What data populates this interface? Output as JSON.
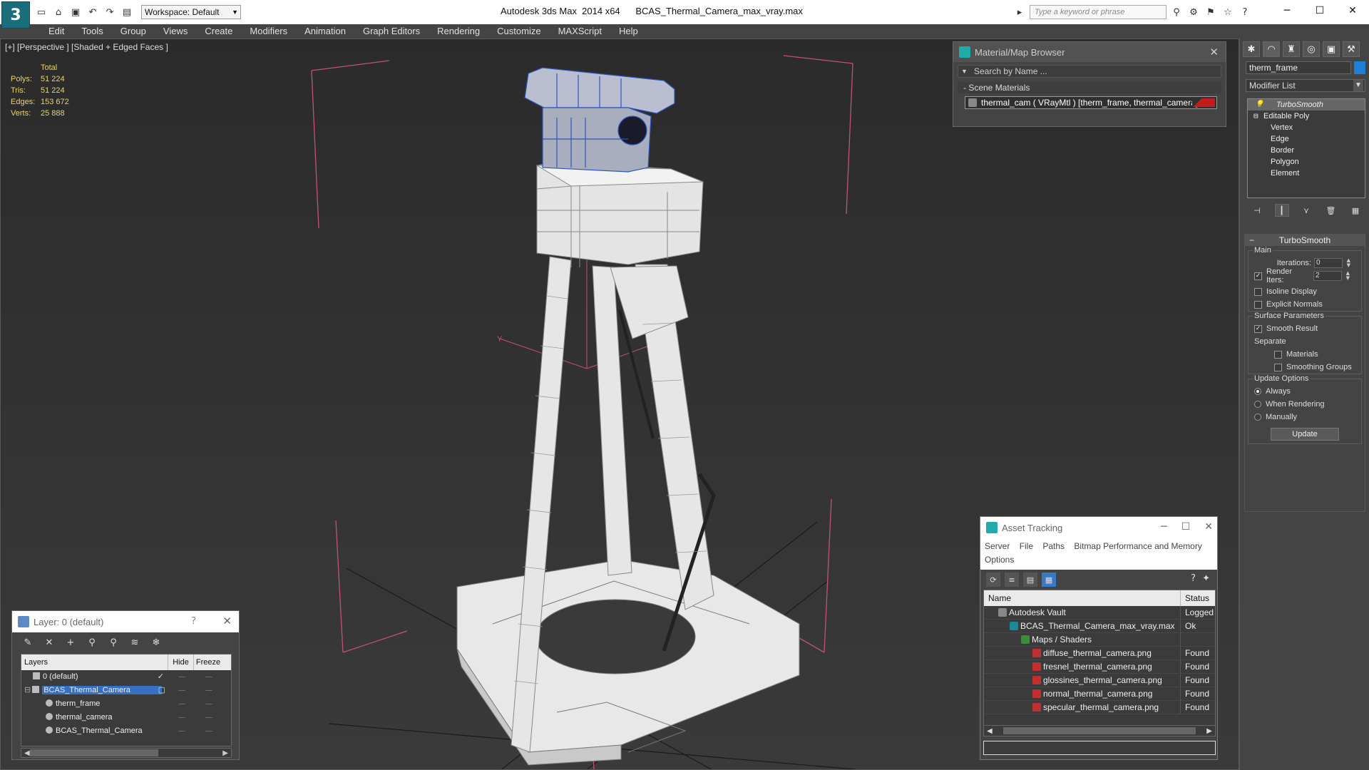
{
  "app": {
    "logo_glyph": "3",
    "window_title": "Autodesk 3ds Max  2014 x64      BCAS_Thermal_Camera_max_vray.max",
    "workspace": "Workspace: Default",
    "search_placeholder": "Type a keyword or phrase",
    "qat_icons": [
      "new-file-icon",
      "open-file-icon",
      "save-icon",
      "undo-icon",
      "redo-icon",
      "project-folder-icon"
    ],
    "title_icons": [
      "binoculars-icon",
      "exchange-icon",
      "infocenter-icon",
      "favorites-star-icon",
      "help-icon"
    ],
    "window_controls": [
      "minimize-icon",
      "maximize-icon",
      "close-icon"
    ]
  },
  "menu": [
    "Edit",
    "Tools",
    "Group",
    "Views",
    "Create",
    "Modifiers",
    "Animation",
    "Graph Editors",
    "Rendering",
    "Customize",
    "MAXScript",
    "Help"
  ],
  "viewport": {
    "label": "[+] [Perspective ] [Shaded + Edged Faces ]",
    "stats": {
      "header": "Total",
      "rows": [
        {
          "k": "Polys:",
          "v": "51 224"
        },
        {
          "k": "Tris:",
          "v": "51 224"
        },
        {
          "k": "Edges:",
          "v": "153 672"
        },
        {
          "k": "Verts:",
          "v": "25 888"
        }
      ]
    },
    "axis_label": "Y",
    "background_colors": {
      "top": "#2b2b2b",
      "bottom": "#3a3a3a",
      "grid": "#1a1a1a",
      "bbox": "#c2546e",
      "selection": "#2f55b8"
    }
  },
  "material_browser": {
    "title": "Material/Map Browser",
    "search": "Search by Name ...",
    "section": "- Scene Materials",
    "material": "thermal_cam  ( VRayMtl )  [therm_frame, thermal_camera]",
    "swatch_color": "#c21c1c"
  },
  "command_panel": {
    "tab_icons": [
      "create-icon",
      "modify-icon",
      "hierarchy-icon",
      "motion-icon",
      "display-icon",
      "utilities-icon"
    ],
    "object_name": "therm_frame",
    "object_color": "#1e7fd4",
    "modifier_list": "Modifier List",
    "stack": {
      "turbosmooth": "TurboSmooth",
      "editable_poly": "Editable Poly",
      "subobjects": [
        "Vertex",
        "Edge",
        "Border",
        "Polygon",
        "Element"
      ]
    },
    "stack_tool_icons": [
      "pin-stack-icon",
      "show-end-result-icon",
      "make-unique-icon",
      "remove-modifier-icon",
      "configure-sets-icon"
    ],
    "turbosmooth": {
      "title": "TurboSmooth",
      "main": "Main",
      "iterations_label": "Iterations:",
      "iterations": "0",
      "render_iters_label": "Render Iters:",
      "render_iters": "2",
      "isoline": "Isoline Display",
      "explicit": "Explicit Normals",
      "surface": "Surface Parameters",
      "smooth_result": "Smooth Result",
      "separate": "Separate",
      "materials": "Materials",
      "smoothing_groups": "Smoothing Groups",
      "update_options": "Update Options",
      "always": "Always",
      "when_rendering": "When Rendering",
      "manually": "Manually",
      "update": "Update"
    }
  },
  "asset_tracking": {
    "title": "Asset Tracking",
    "menu": [
      "Server",
      "File",
      "Paths",
      "Bitmap Performance and Memory",
      "Options"
    ],
    "toolbar_icons": [
      "refresh-icon",
      "list-view-icon",
      "thumbnail-view-icon",
      "table-view-icon"
    ],
    "columns": {
      "name": "Name",
      "status": "Status"
    },
    "rows": [
      {
        "name": "Autodesk Vault",
        "status": "Logged",
        "indent": 1,
        "icon": "vault"
      },
      {
        "name": "BCAS_Thermal_Camera_max_vray.max",
        "status": "Ok",
        "indent": 2,
        "icon": "max"
      },
      {
        "name": "Maps / Shaders",
        "status": "",
        "indent": 3,
        "icon": "folder"
      },
      {
        "name": "diffuse_thermal_camera.png",
        "status": "Found",
        "indent": 4,
        "icon": "png"
      },
      {
        "name": "fresnel_thermal_camera.png",
        "status": "Found",
        "indent": 4,
        "icon": "png"
      },
      {
        "name": "glossines_thermal_camera.png",
        "status": "Found",
        "indent": 4,
        "icon": "png"
      },
      {
        "name": "normal_thermal_camera.png",
        "status": "Found",
        "indent": 4,
        "icon": "png"
      },
      {
        "name": "specular_thermal_camera.png",
        "status": "Found",
        "indent": 4,
        "icon": "png"
      }
    ]
  },
  "layer_panel": {
    "title": "Layer: 0 (default)",
    "help": "?",
    "toolbar_icons": [
      "new-layer-icon",
      "delete-layer-icon",
      "add-to-layer-icon",
      "select-in-layer-icon",
      "highlight-layer-icon",
      "hide-all-icon",
      "freeze-all-icon"
    ],
    "columns": {
      "layers": "Layers",
      "hide": "Hide",
      "freeze": "Freeze"
    },
    "rows": [
      {
        "name": "0 (default)",
        "indent": 1,
        "selected": false,
        "active": true
      },
      {
        "name": "BCAS_Thermal_Camera",
        "indent": 1,
        "selected": true,
        "active": false
      },
      {
        "name": "therm_frame",
        "indent": 2,
        "selected": false,
        "active": false
      },
      {
        "name": "thermal_camera",
        "indent": 2,
        "selected": false,
        "active": false
      },
      {
        "name": "BCAS_Thermal_Camera",
        "indent": 2,
        "selected": false,
        "active": false
      }
    ]
  }
}
